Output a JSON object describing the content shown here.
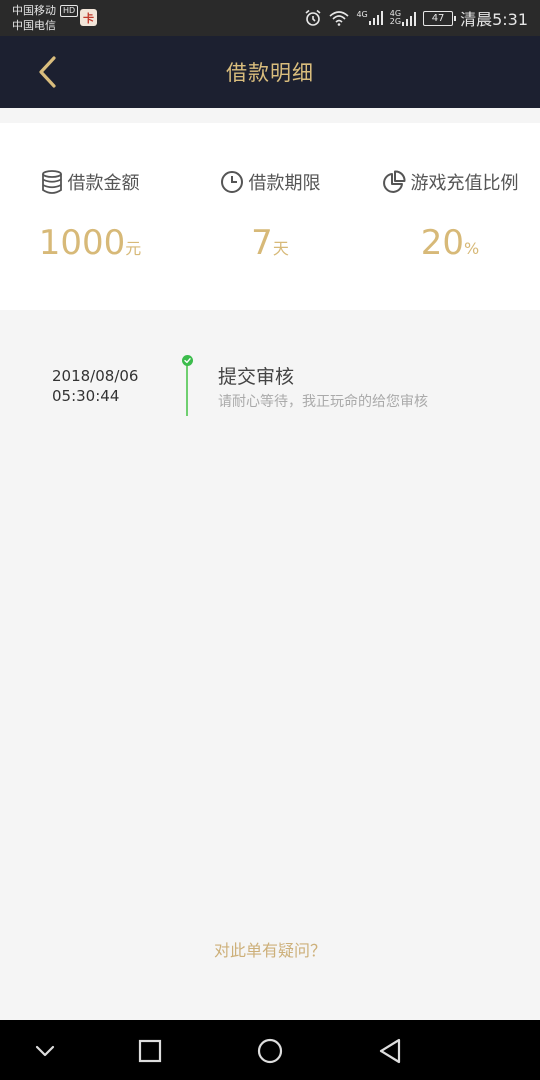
{
  "status_bar": {
    "carrier_1": "中国移动",
    "hd_badge": "HD",
    "carrier_2": "中国电信",
    "app_badge": "卡",
    "network_4g": "4G",
    "network_4g_2": "4G",
    "network_2g": "2G",
    "battery": "47",
    "time": "清晨5:31"
  },
  "header": {
    "title": "借款明细"
  },
  "stats": [
    {
      "label": "借款金额",
      "value": "1000",
      "unit": "元",
      "icon": "coin-stack-icon"
    },
    {
      "label": "借款期限",
      "value": "7",
      "unit": "天",
      "icon": "clock-icon"
    },
    {
      "label": "游戏充值比例",
      "value": "20",
      "unit": "%",
      "icon": "pie-chart-icon"
    }
  ],
  "timeline": [
    {
      "date": "2018/08/06",
      "time": "05:30:44",
      "title": "提交审核",
      "subtitle": "请耐心等待，我正玩命的给您审核"
    }
  ],
  "footer": {
    "question": "对此单有疑问？"
  },
  "colors": {
    "header_bg": "#1c2030",
    "accent_gold": "#d7b978",
    "status_green": "#3cbc4c"
  }
}
